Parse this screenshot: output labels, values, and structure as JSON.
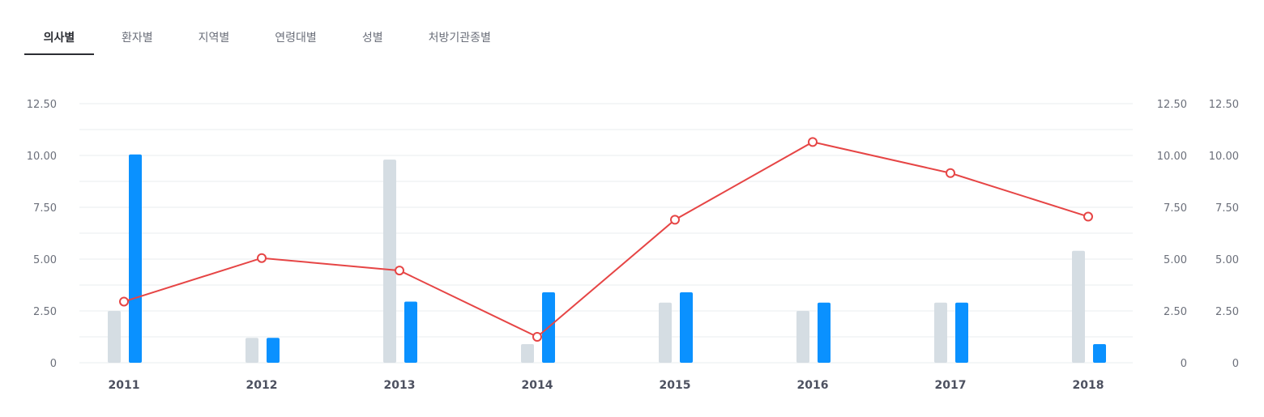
{
  "tabs": [
    {
      "label": "의사별",
      "active": true
    },
    {
      "label": "환자별",
      "active": false
    },
    {
      "label": "지역별",
      "active": false
    },
    {
      "label": "연령대별",
      "active": false
    },
    {
      "label": "성별",
      "active": false
    },
    {
      "label": "처방기관종별",
      "active": false
    }
  ],
  "colors": {
    "bar_gray": "#d5dde3",
    "bar_blue": "#0a91ff",
    "line_red": "#e64545",
    "grid": "#e9ecef",
    "tick_text": "#6b6f7a",
    "category_text": "#4d5160"
  },
  "chart_data": {
    "type": "bar",
    "categories": [
      "2011",
      "2012",
      "2013",
      "2014",
      "2015",
      "2016",
      "2017",
      "2018"
    ],
    "series": [
      {
        "type": "bar",
        "axis": "left",
        "color": "#d5dde3",
        "values": [
          2.5,
          1.2,
          9.8,
          0.9,
          2.9,
          2.5,
          2.9,
          5.4
        ]
      },
      {
        "type": "bar",
        "axis": "left",
        "color": "#0a91ff",
        "values": [
          10.05,
          1.2,
          2.95,
          3.4,
          3.4,
          2.9,
          2.9,
          0.9
        ]
      },
      {
        "type": "line",
        "axis": "right",
        "color": "#e64545",
        "values": [
          2.95,
          5.05,
          4.45,
          1.25,
          6.9,
          10.65,
          9.15,
          7.05
        ]
      }
    ],
    "ylim": [
      0,
      12.5
    ],
    "y_ticks": [
      "0",
      "2.50",
      "5.00",
      "7.50",
      "10.00",
      "12.50"
    ],
    "y2_ticks": [
      "0",
      "2.50",
      "5.00",
      "7.50",
      "10.00",
      "12.50"
    ],
    "y3_ticks": [
      "0",
      "2.50",
      "5.00",
      "7.50",
      "10.00",
      "12.50"
    ],
    "grid": true,
    "legend": "none",
    "xlabel": "",
    "ylabel": ""
  }
}
